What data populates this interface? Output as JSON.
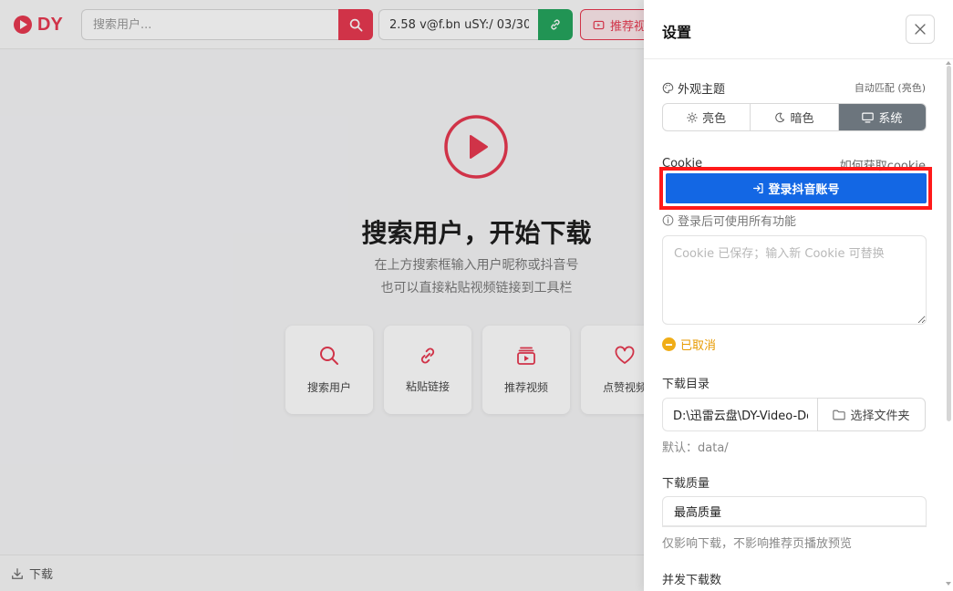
{
  "app": {
    "logo_text": "DY",
    "search": {
      "placeholder": "搜索用户..."
    },
    "link_input": {
      "value": "2.58 v@f.bn uSY:/ 03/30"
    },
    "recommend_button": "推荐视",
    "hero": {
      "title": "搜索用户，开始下载",
      "subtitle_1": "在上方搜索框输入用户昵称或抖音号",
      "subtitle_2": "也可以直接粘贴视频链接到工具栏"
    },
    "cards": [
      {
        "label": "搜索用户",
        "icon": "search-icon"
      },
      {
        "label": "粘贴链接",
        "icon": "link-icon"
      },
      {
        "label": "推荐视频",
        "icon": "video-stack-icon"
      },
      {
        "label": "点赞视频",
        "icon": "heart-icon"
      }
    ],
    "bottom_tab": "下载",
    "colors": {
      "brand": "#e8354d",
      "link_green": "#20a35a"
    }
  },
  "settings": {
    "title": "设置",
    "appearance": {
      "label": "外观主题",
      "auto_hint": "自动匹配 (亮色)",
      "options": [
        {
          "label": "亮色",
          "icon": "sun-icon"
        },
        {
          "label": "暗色",
          "icon": "moon-icon"
        },
        {
          "label": "系统",
          "icon": "monitor-icon"
        }
      ],
      "selected": "系统"
    },
    "cookie": {
      "label": "Cookie",
      "help_link": "如何获取cookie",
      "login_button": "登录抖音账号",
      "login_hint": "登录后可使用所有功能",
      "placeholder": "Cookie 已保存；输入新 Cookie 可替换",
      "status": "已取消"
    },
    "download_dir": {
      "label": "下载目录",
      "value": "D:\\迅雷云盘\\DY-Video-Downloader",
      "choose_button": "选择文件夹",
      "default_hint": "默认：data/"
    },
    "quality": {
      "label": "下载质量",
      "value": "最高质量",
      "hint": "仅影响下载，不影响推荐页播放预览"
    },
    "concurrency": {
      "label": "并发下载数"
    },
    "colors": {
      "login_button": "#1367e4",
      "highlight": "#ff1a1a",
      "status": "#e79a00"
    }
  }
}
